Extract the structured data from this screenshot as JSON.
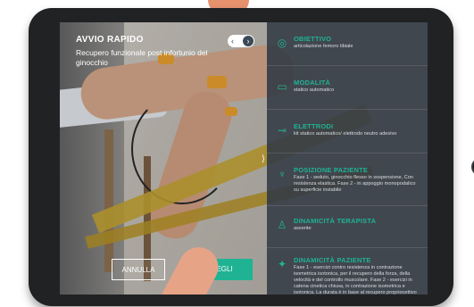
{
  "header": {
    "title": "AVVIO RAPIDO",
    "subtitle": "Recupero funzionale post infortunio del ginocchio"
  },
  "toggle": {
    "left": "‹",
    "right": "›"
  },
  "buttons": {
    "cancel": "ANNULLA",
    "choose": "SCEGLI"
  },
  "panel": {
    "scroll_hint": "⟩",
    "items": [
      {
        "icon": "target-icon",
        "heading": "OBIETTIVO",
        "detail": "articolazione femoro tibiale"
      },
      {
        "icon": "monitor-icon",
        "heading": "MODALITÀ",
        "detail": "statico automatico"
      },
      {
        "icon": "electrode-icon",
        "heading": "ELETTRODI",
        "detail": "kit statico automatico/ elettrodo neutro adesivo"
      },
      {
        "icon": "patient-position-icon",
        "heading": "POSIZIONE PAZIENTE",
        "detail": "Fase 1 - seduto, ginocchio flesso in sospensione, Con resistenza elastica. Fase 2 - in appoggio monopodalico su superficie instabile"
      },
      {
        "icon": "therapist-icon",
        "heading": "DINAMICITÀ TERAPISTA",
        "detail": "assente"
      },
      {
        "icon": "patient-dynamic-icon",
        "heading": "DINAMICITÀ PAZIENTE",
        "detail": "Fase 1 - esercizi contro resistenza in contrazione isometrica isotonica, per il recupero della forza, della velocità e del controllo muscolare. Fase 2 - esercizi in catena cinetica chiusa, in contrazione isometrica e isotonica. La durata è in base al recupero propriocettivo"
      }
    ]
  },
  "colors": {
    "accent": "#1fb394",
    "panel": "#343b44",
    "device": "#202224"
  }
}
